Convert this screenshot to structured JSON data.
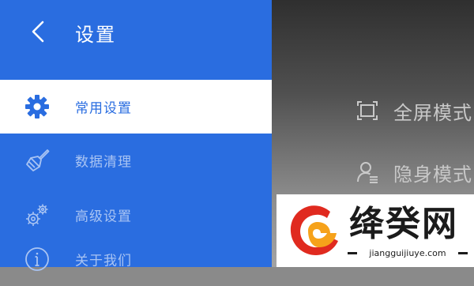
{
  "drawer": {
    "title": "设置",
    "back_icon": "chevron-left-icon",
    "items": [
      {
        "label": "常用设置",
        "icon": "gear-icon",
        "active": true
      },
      {
        "label": "数据清理",
        "icon": "broom-icon",
        "active": false
      },
      {
        "label": "高级设置",
        "icon": "gears-icon",
        "active": false
      },
      {
        "label": "关于我们",
        "icon": "info-icon",
        "active": false
      }
    ]
  },
  "right_options": [
    {
      "label": "全屏模式",
      "icon": "fullscreen-icon"
    },
    {
      "label": "隐身模式",
      "icon": "user-incognito-icon"
    }
  ],
  "watermark": {
    "name": "绛癸网",
    "url": "jiangguijiuye.com"
  },
  "colors": {
    "accent": "#2a6de0",
    "inactive_text": "#a9c4f3",
    "right_text": "#c9c9c9",
    "logo_red": "#e02a1f",
    "logo_orange": "#f6a21a"
  }
}
